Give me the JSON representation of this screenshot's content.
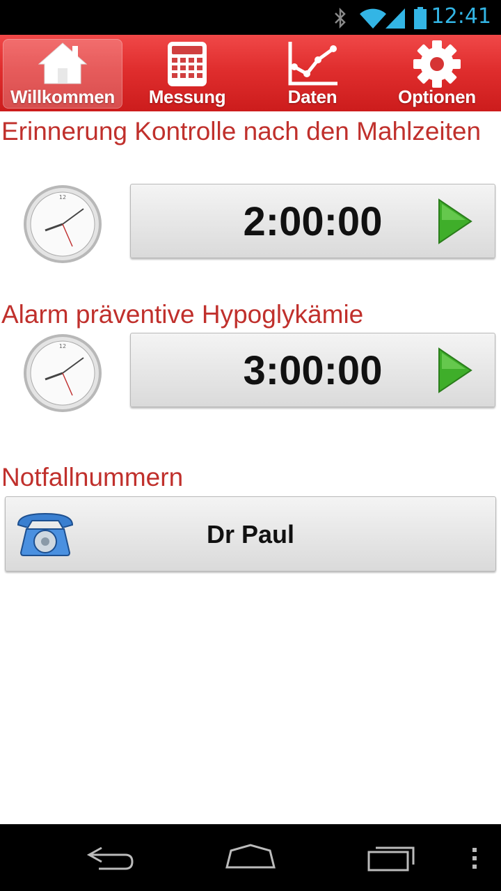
{
  "status_bar": {
    "time": "12:41",
    "icons": [
      "bluetooth-icon",
      "wifi-icon",
      "signal-icon",
      "battery-icon"
    ],
    "accent_color": "#33b5e5"
  },
  "tabs": [
    {
      "label": "Willkommen",
      "icon": "house-icon",
      "selected": true
    },
    {
      "label": "Messung",
      "icon": "calculator-icon",
      "selected": false
    },
    {
      "label": "Daten",
      "icon": "line-chart-icon",
      "selected": false
    },
    {
      "label": "Optionen",
      "icon": "gear-icon",
      "selected": false
    }
  ],
  "reminders": [
    {
      "title": "Erinnerung Kontrolle nach den Mahlzeiten",
      "value": "2:00:00",
      "icon": "clock-icon",
      "action_icon": "play-icon"
    },
    {
      "title": "Alarm präventive Hypoglykämie",
      "value": "3:00:00",
      "icon": "clock-icon",
      "action_icon": "play-icon"
    }
  ],
  "emergency": {
    "title": "Notfallnummern",
    "contacts": [
      {
        "name": "Dr Paul",
        "icon": "telephone-icon"
      }
    ]
  },
  "nav_bar": {
    "buttons": [
      "back-icon",
      "home-icon",
      "recent-apps-icon",
      "overflow-menu-icon"
    ]
  },
  "colors": {
    "brand_red": "#e02e2e",
    "title_red": "#c0302c",
    "play_green": "#3fae2a"
  }
}
